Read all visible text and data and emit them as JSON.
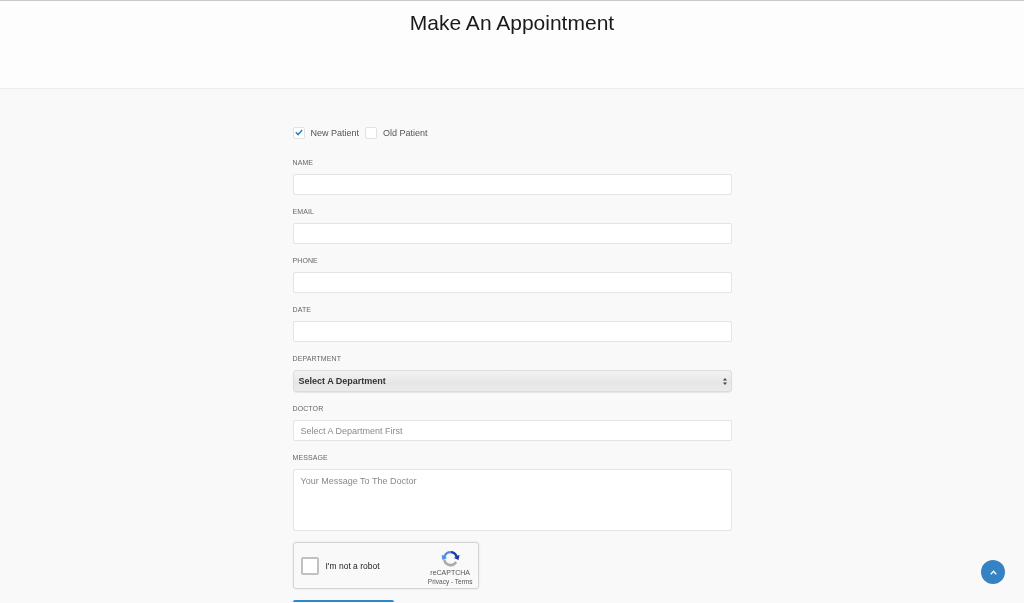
{
  "page": {
    "title": "Make An Appointment"
  },
  "patient_type": [
    {
      "label": "New Patient",
      "checked": true
    },
    {
      "label": "Old Patient",
      "checked": false
    }
  ],
  "fields": [
    {
      "kind": "input",
      "label": "NAME"
    },
    {
      "kind": "input",
      "label": "EMAIL"
    },
    {
      "kind": "input",
      "label": "PHONE"
    },
    {
      "kind": "input",
      "label": "DATE"
    },
    {
      "kind": "select",
      "label": "DEPARTMENT",
      "value": "Select A Department"
    },
    {
      "kind": "input",
      "label": "DOCTOR",
      "placeholder": "Select A Department First"
    },
    {
      "kind": "textarea",
      "label": "MESSAGE",
      "placeholder": "Your Message To The Doctor"
    }
  ],
  "captcha": {
    "label": "I'm not a robot",
    "checked": false,
    "brand": "reCAPTCHA",
    "footer": "Privacy - Terms"
  }
}
